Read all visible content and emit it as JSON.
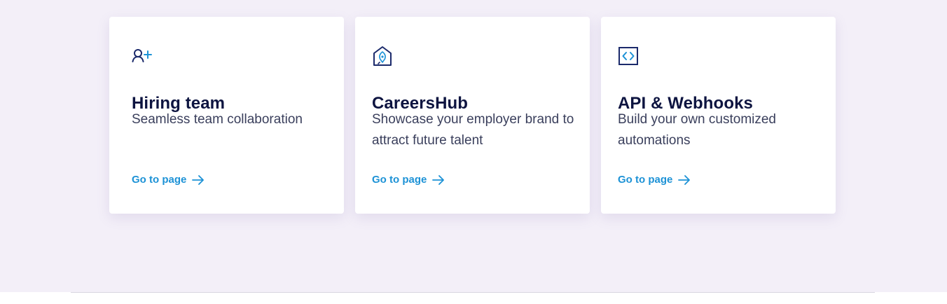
{
  "cards": [
    {
      "icon": "add-user-icon",
      "title": "Hiring team",
      "description": "Seamless team collaboration",
      "link_label": "Go to page"
    },
    {
      "icon": "pen-nib-house-icon",
      "title": "CareersHub",
      "description": "Showcase your employer brand to attract future talent",
      "link_label": "Go to page"
    },
    {
      "icon": "code-brackets-icon",
      "title": "API & Webhooks",
      "description": "Build your own customized automations",
      "link_label": "Go to page"
    }
  ],
  "colors": {
    "page_background": "#f3eff8",
    "card_background": "#ffffff",
    "title": "#0d1440",
    "body_text": "#3a3f5c",
    "link": "#1d92d6",
    "icon_primary": "#1b2a6b",
    "icon_accent": "#1d92d6"
  }
}
